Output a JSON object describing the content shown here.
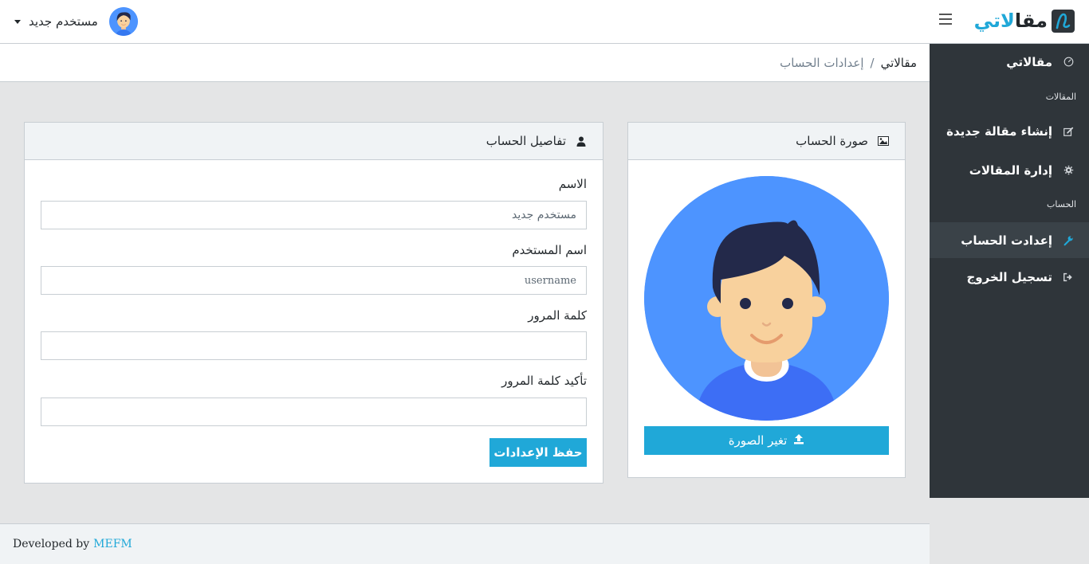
{
  "header": {
    "brand_part1": "مقا",
    "brand_part2": "لاتي",
    "user_name": "مستخدم جديد"
  },
  "breadcrumb": {
    "home": "مقالاتي",
    "separator": "/",
    "current": "إعدادات الحساب"
  },
  "sidebar": {
    "dashboard": "مقالاتي",
    "section_articles": "المقالات",
    "new_article": "إنشاء مقالة جديدة",
    "manage_articles": "إدارة المقالات",
    "section_account": "الحساب",
    "account_settings": "إعدادت الحساب",
    "logout": "تسجيل الخروج"
  },
  "photo_card": {
    "title": "صورة الحساب",
    "upload_button": "تغير الصورة"
  },
  "details_card": {
    "title": "تفاصيل الحساب",
    "name_label": "الاسم",
    "name_value": "مستخدم جديد",
    "username_label": "اسم المستخدم",
    "username_value": "username",
    "password_label": "كلمة المرور",
    "confirm_label": "تأكيد كلمة المرور",
    "save_button": "حفظ الإعدادات"
  },
  "footer": {
    "prefix": "Developed by",
    "link": "MEFM"
  },
  "colors": {
    "accent": "#20a8d8",
    "sidebar": "#2f353a",
    "avatar_bg": "#4d94ff"
  }
}
